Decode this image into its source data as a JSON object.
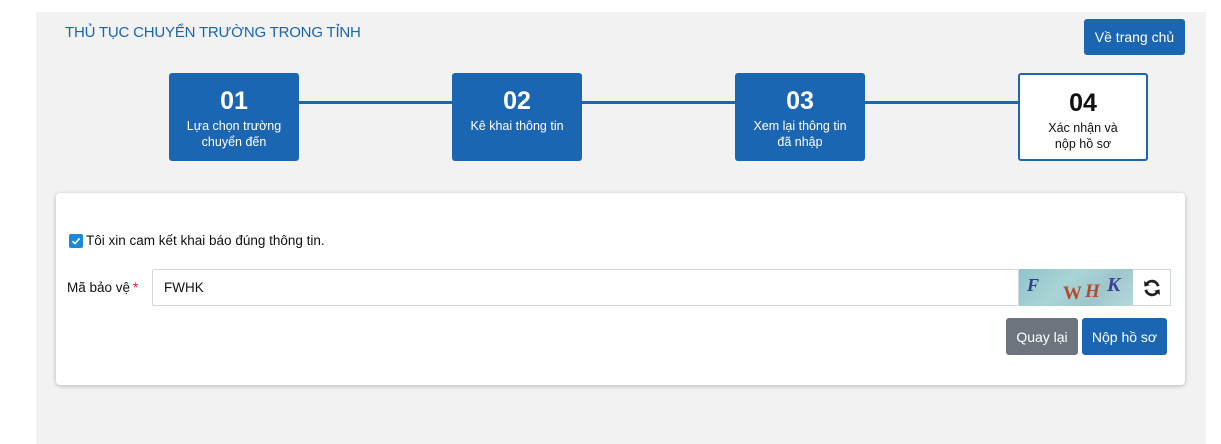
{
  "header": {
    "title": "THỦ TỤC CHUYỂN TRƯỜNG TRONG TỈNH",
    "home_button": "Về trang chủ"
  },
  "steps": [
    {
      "num": "01",
      "label": "Lựa chọn trường chuyển đến",
      "state": "done"
    },
    {
      "num": "02",
      "label": "Kê khai thông tin",
      "state": "done"
    },
    {
      "num": "03",
      "label": "Xem lại thông tin đã nhập",
      "state": "done"
    },
    {
      "num": "04",
      "label": "Xác nhận và nộp hồ sơ",
      "state": "active"
    }
  ],
  "form": {
    "commitment": {
      "checked": true,
      "label": "Tôi xin cam kết khai báo đúng thông tin."
    },
    "captcha": {
      "label": "Mã bảo vệ",
      "required_mark": "*",
      "value": "FWHK",
      "image_text": "FWHK"
    },
    "back_button": "Quay lại",
    "submit_button": "Nộp hồ sơ"
  },
  "colors": {
    "primary": "#1a66b3",
    "secondary": "#6c757d",
    "required": "#e02020",
    "background": "#f2f2f2"
  }
}
